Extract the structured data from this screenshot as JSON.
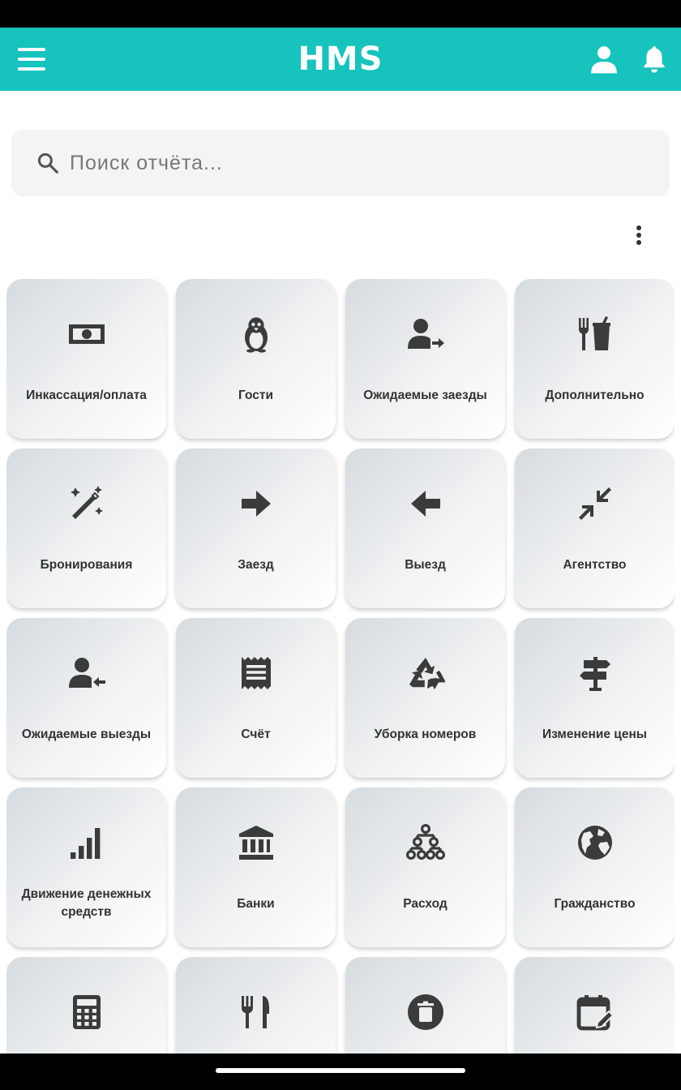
{
  "app": {
    "title": "HMS",
    "accent_color": "#17c3bd"
  },
  "header": {
    "menu_icon": "hamburger-menu-icon",
    "user_icon": "person-icon",
    "notifications_icon": "bell-icon"
  },
  "search": {
    "placeholder": "Поиск отчёта...",
    "value": "",
    "icon": "search-icon"
  },
  "toolbar": {
    "more_icon": "more-vertical-icon"
  },
  "reports": [
    {
      "label": "Инкассация/оплата",
      "icon": "cash-icon"
    },
    {
      "label": "Гости",
      "icon": "penguin-icon"
    },
    {
      "label": "Ожидаемые заезды",
      "icon": "person-arrow-right-icon"
    },
    {
      "label": "Дополнительно",
      "icon": "fork-knife-cup-icon"
    },
    {
      "label": "Бронирования",
      "icon": "magic-wand-icon"
    },
    {
      "label": "Заезд",
      "icon": "arrow-right-icon"
    },
    {
      "label": "Выезд",
      "icon": "arrow-left-icon"
    },
    {
      "label": "Агентство",
      "icon": "collapse-arrows-icon"
    },
    {
      "label": "Ожидаемые выезды",
      "icon": "person-arrow-left-icon"
    },
    {
      "label": "Счёт",
      "icon": "receipt-icon"
    },
    {
      "label": "Уборка номеров",
      "icon": "recycle-icon"
    },
    {
      "label": "Изменение цены",
      "icon": "signpost-icon"
    },
    {
      "label": "Движение денежных средств",
      "icon": "signal-bars-icon"
    },
    {
      "label": "Банки",
      "icon": "bank-icon"
    },
    {
      "label": "Расход",
      "icon": "hierarchy-icon"
    },
    {
      "label": "Гражданство",
      "icon": "globe-icon"
    },
    {
      "label": "",
      "icon": "calculator-icon"
    },
    {
      "label": "",
      "icon": "restaurant-icon"
    },
    {
      "label": "",
      "icon": "delete-circle-icon"
    },
    {
      "label": "",
      "icon": "calendar-edit-icon"
    }
  ]
}
